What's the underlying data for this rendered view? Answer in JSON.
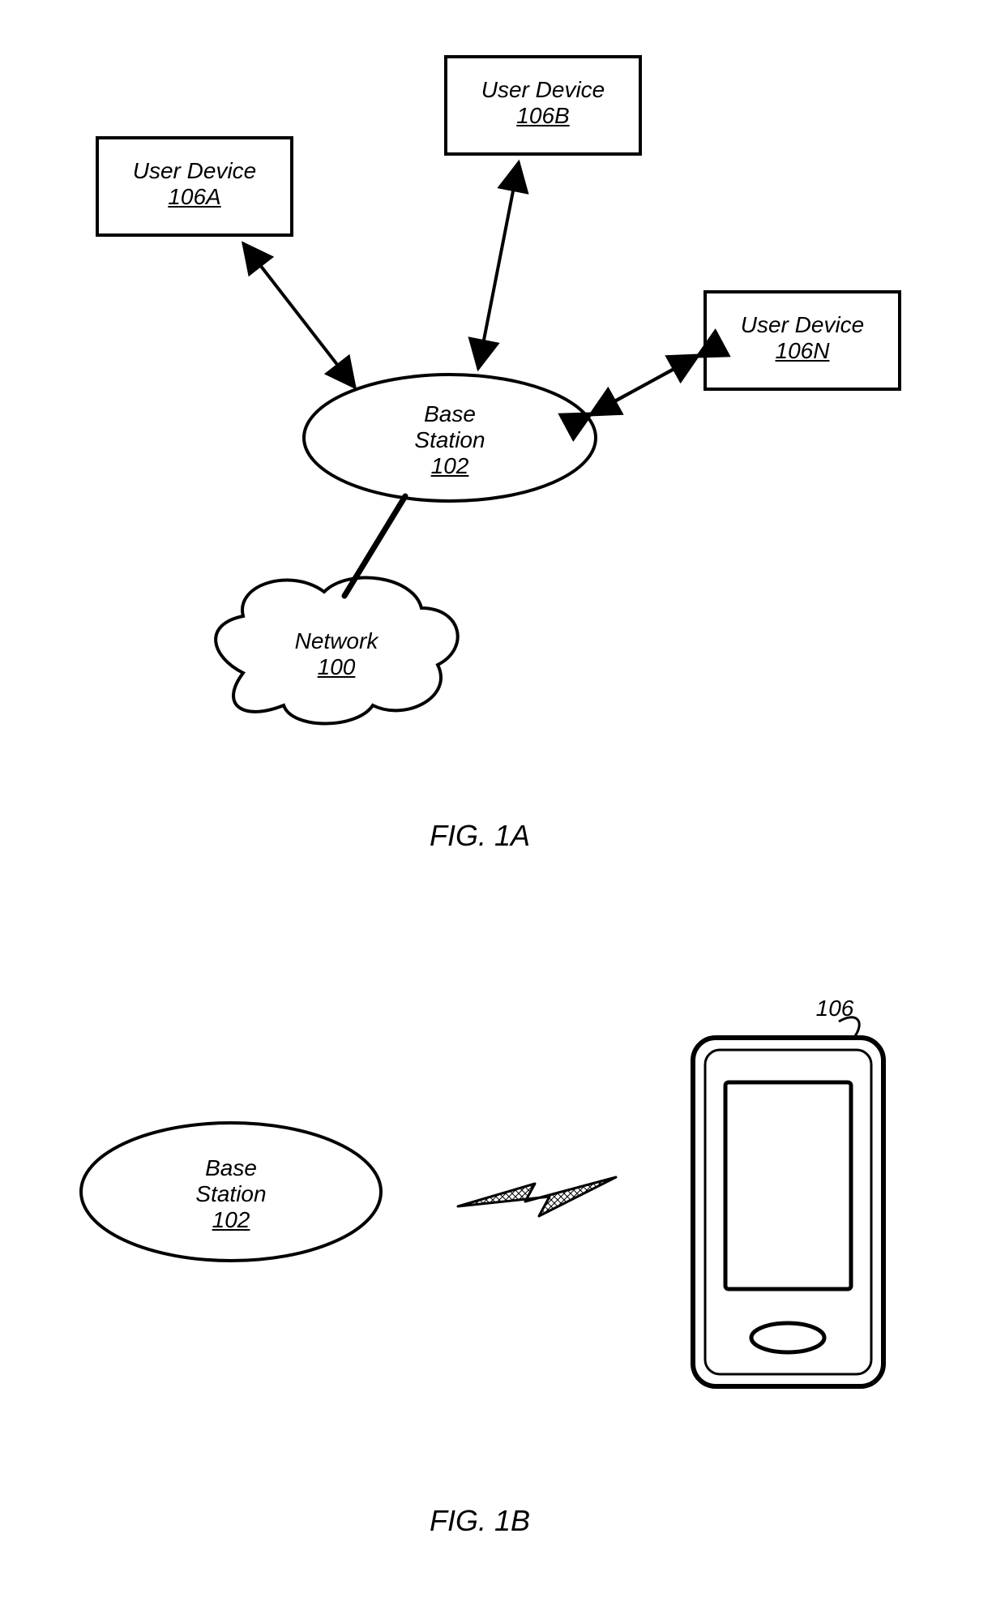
{
  "figA": {
    "caption": "FIG. 1A",
    "userDeviceA": {
      "title": "User Device",
      "ref": "106A"
    },
    "userDeviceB": {
      "title": "User Device",
      "ref": "106B"
    },
    "userDeviceN": {
      "title": "User Device",
      "ref": "106N"
    },
    "baseStation": {
      "title1": "Base",
      "title2": "Station",
      "ref": "102"
    },
    "network": {
      "title": "Network",
      "ref": "100"
    }
  },
  "figB": {
    "caption": "FIG. 1B",
    "baseStation": {
      "title1": "Base",
      "title2": "Station",
      "ref": "102"
    },
    "phoneRef": "106"
  }
}
